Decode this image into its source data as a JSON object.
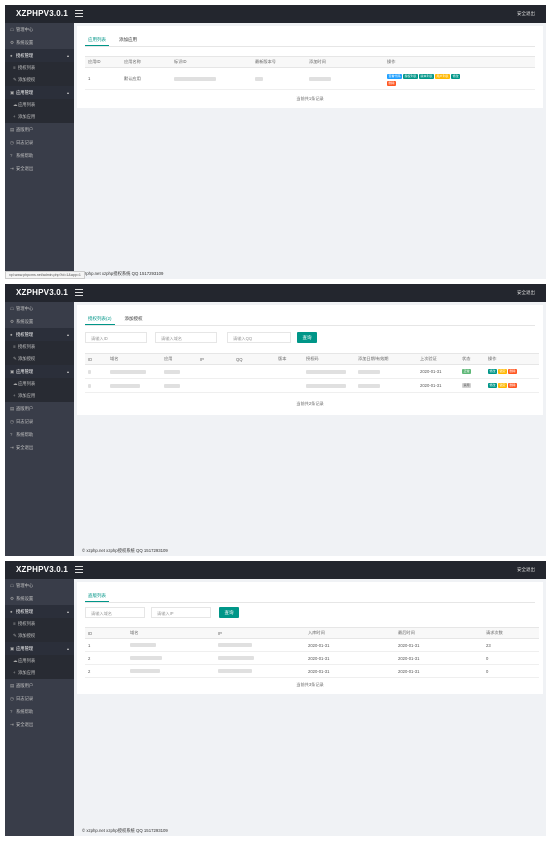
{
  "header": {
    "brand": "XZPHPV3.0.1",
    "right": "安全退出"
  },
  "menu": {
    "items": [
      "管理中心",
      "系统设置",
      "授权管理",
      "授权列表",
      "添加授权",
      "应用管理",
      "应用列表",
      "添加应用",
      "盗版用户",
      "日志记录",
      "系统帮助",
      "安全退出"
    ]
  },
  "p1": {
    "tabs": [
      "应用列表",
      "添加应用"
    ],
    "cols": [
      "应用ID",
      "应用名称",
      "标识ID",
      "最新版本号",
      "添加时间",
      "操作"
    ],
    "row": {
      "id": "1",
      "name": "默认应用"
    },
    "buttons": [
      "查看代码",
      "授权列表",
      "版本列表",
      "用户列表",
      "修改",
      "删除"
    ],
    "total": "当前共1条记录",
    "status_url": "xpl.www.phpcms.net/admin.php?id=1&app=1",
    "status_time": "xzphp.net xzphp授权系统 QQ 1517293109"
  },
  "p2": {
    "tabs": [
      "授权列表(2)",
      "添加授权"
    ],
    "filters": [
      "请输入ID",
      "请输入域名",
      "请输入QQ"
    ],
    "query": "查询",
    "cols": [
      "ID",
      "域名",
      "应用",
      "IP",
      "QQ",
      "版本",
      "授权码",
      "添加日期/有效期",
      "上次验证",
      "状态",
      "操作"
    ],
    "rows": [
      {
        "date": "2020-01-31",
        "status": "正常",
        "btns": [
          "修改",
          "锁定",
          "删除"
        ]
      },
      {
        "date": "2020-01-31",
        "status": "禁用",
        "btns": [
          "修改",
          "锁定",
          "删除"
        ]
      }
    ],
    "total": "当前共2条记录",
    "footer": "© xzphp.net xzphp授权系统 QQ 1517293109"
  },
  "p3": {
    "tabs": [
      "盗版列表"
    ],
    "filters": [
      "请输入域名",
      "请输入IP"
    ],
    "query": "查询",
    "cols": [
      "ID",
      "域名",
      "IP",
      "入库时间",
      "最后时间",
      "请求次数"
    ],
    "rows": [
      {
        "id": "1",
        "in": "2020-01-31",
        "last": "2020-01-31",
        "count": "23"
      },
      {
        "id": "2",
        "in": "2020-01-31",
        "last": "2020-01-31",
        "count": "0"
      },
      {
        "id": "2",
        "in": "2020-01-31",
        "last": "2020-01-31",
        "count": "0"
      }
    ],
    "total": "当前共3条记录",
    "footer": "© xzphp.net xzphp授权系统 QQ 1517293109"
  }
}
